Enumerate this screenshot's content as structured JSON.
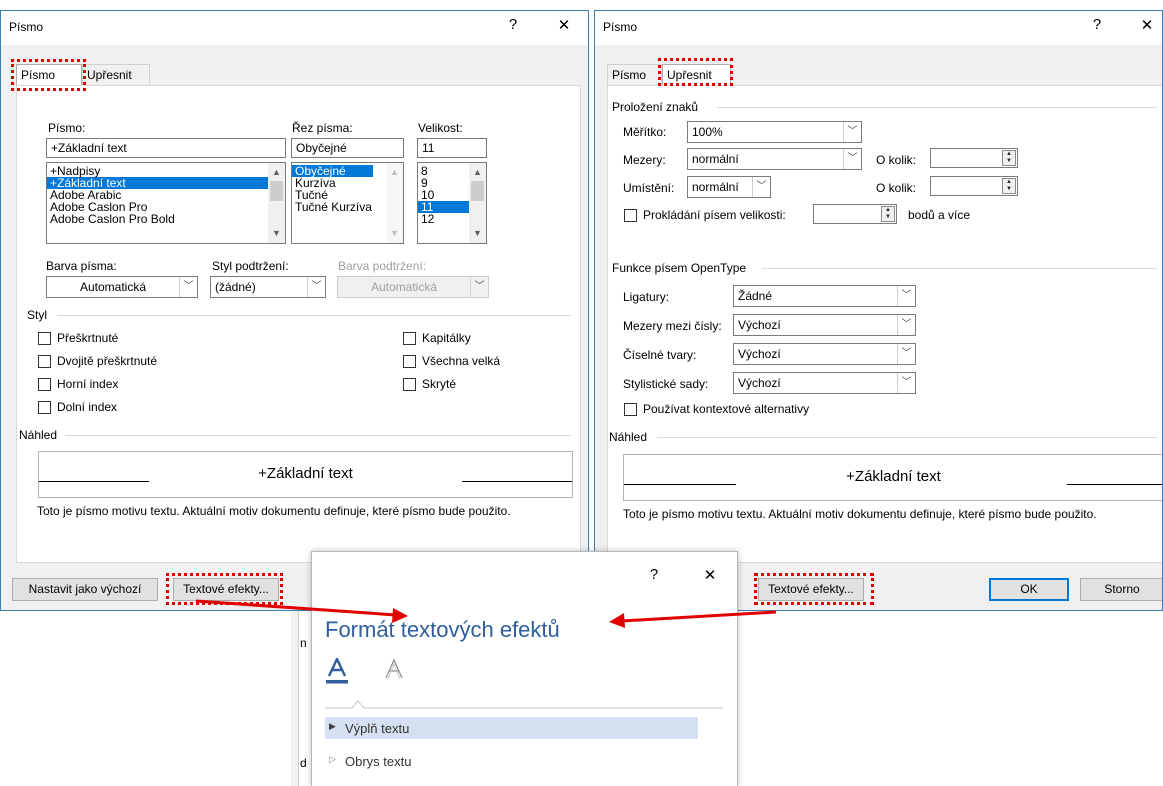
{
  "colors": {
    "highlight": "#e00000",
    "selection": "#0078d7",
    "accent_blue": "#2e5e9b",
    "arrow": "#e00000"
  },
  "left_dialog": {
    "title": "Písmo",
    "help": "?",
    "close": "✕",
    "tabs": [
      "Písmo",
      "Upřesnit"
    ],
    "font_label": "Písmo:",
    "font_value": "+Základní text",
    "font_list": [
      "+Nadpisy",
      "+Základní text",
      "Adobe Arabic",
      "Adobe Caslon Pro",
      "Adobe Caslon Pro Bold"
    ],
    "style_label": "Řez písma:",
    "style_value": "Obyčejné",
    "style_list": [
      "Obyčejné",
      "Kurzíva",
      "Tučné",
      "Tučné Kurzíva"
    ],
    "size_label": "Velikost:",
    "size_value": "11",
    "size_list": [
      "8",
      "9",
      "10",
      "11",
      "12"
    ],
    "color_label": "Barva písma:",
    "color_value": "Automatická",
    "underline_label": "Styl podtržení:",
    "underline_value": "(žádné)",
    "underline_color_label": "Barva podtržení:",
    "underline_color_value": "Automatická",
    "effects_group": "Styl",
    "effects_left": [
      "Přeškrtnuté",
      "Dvojitě přeškrtnuté",
      "Horní index",
      "Dolní index"
    ],
    "effects_right": [
      "Kapitálky",
      "Všechna velká",
      "Skryté"
    ],
    "preview_group": "Náhled",
    "preview_text": "+Základní text",
    "note": "Toto je písmo motivu textu. Aktuální motiv dokumentu definuje, které písmo bude použito.",
    "set_default_button": "Nastavit jako výchozí",
    "text_effects_button": "Textové efekty..."
  },
  "right_dialog": {
    "title": "Písmo",
    "help": "?",
    "close": "✕",
    "tabs": [
      "Písmo",
      "Upřesnit"
    ],
    "spacing_group": "Proložení znaků",
    "scale_label": "Měřítko:",
    "scale_value": "100%",
    "spacing_label": "Mezery:",
    "spacing_value": "normální",
    "spacing_by_label": "O kolik:",
    "position_label": "Umístění:",
    "position_value": "normální",
    "position_by_label": "O kolik:",
    "kerning_label": "Prokládání písem velikosti:",
    "kerning_suffix": "bodů a více",
    "opentype_group": "Funkce písem OpenType",
    "ligatures_label": "Ligatury:",
    "ligatures_value": "Žádné",
    "num_spacing_label": "Mezery mezi čísly:",
    "num_spacing_value": "Výchozí",
    "num_forms_label": "Číselné tvary:",
    "num_forms_value": "Výchozí",
    "stylistic_label": "Stylistické sady:",
    "stylistic_value": "Výchozí",
    "contextual_label": "Používat kontextové alternativy",
    "preview_group": "Náhled",
    "preview_text": "+Základní text",
    "note": "Toto je písmo motivu textu. Aktuální motiv dokumentu definuje, které písmo bude použito.",
    "text_effects_button": "Textové efekty...",
    "ok_button": "OK",
    "cancel_button": "Storno"
  },
  "effects_pane": {
    "help": "?",
    "close": "✕",
    "title": "Formát textových efektů",
    "section_fill": "Výplň textu",
    "section_outline": "Obrys textu"
  },
  "background_fragments": [
    "n",
    "d"
  ]
}
